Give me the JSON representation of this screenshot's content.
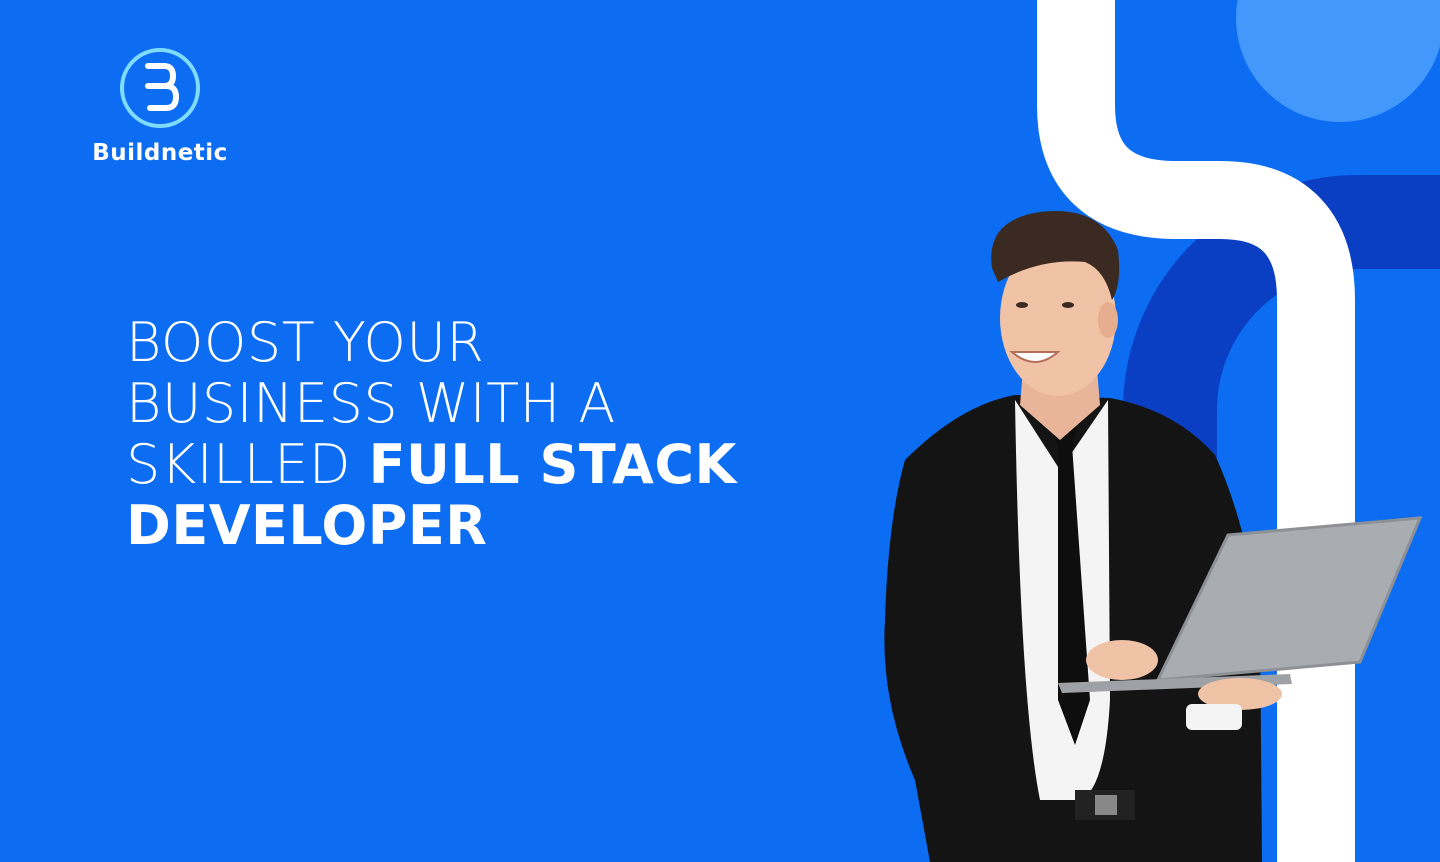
{
  "brand": {
    "name": "Buildnetic",
    "logo_icon": "b-circle-logo-icon"
  },
  "headline": {
    "line1": "BOOST YOUR",
    "line2": "BUSINESS WITH A",
    "line3_light": "SKILLED ",
    "line3_bold": "FULL STACK",
    "line4_bold": "DEVELOPER"
  },
  "colors": {
    "background": "#0c6df2",
    "light_circle": "#4398fb",
    "dark_arc": "#0a3fc4",
    "white": "#ffffff",
    "suit": "#141414",
    "laptop": "#a9adb2"
  }
}
